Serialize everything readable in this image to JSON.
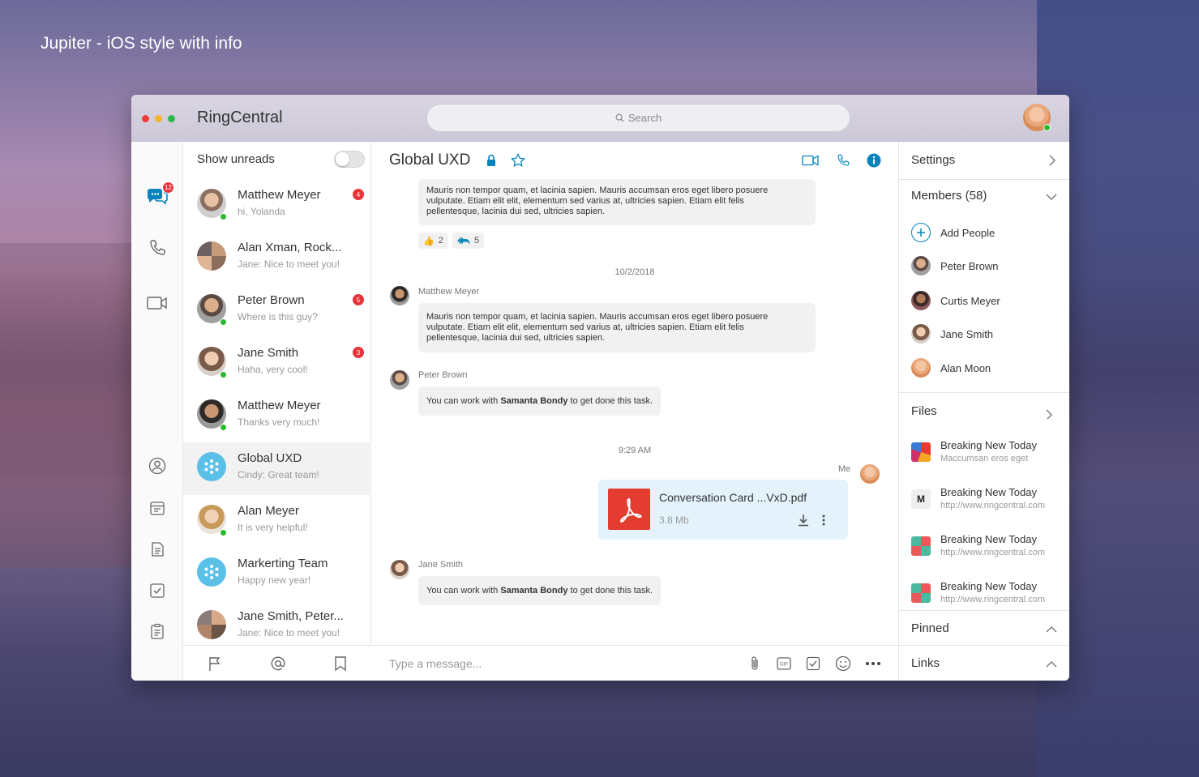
{
  "caption": "Jupiter - iOS style with info",
  "app": {
    "title": "RingCentral",
    "search_placeholder": "Search",
    "rail_badge": "12"
  },
  "convlist": {
    "show_unreads": "Show unreads",
    "items": [
      {
        "name": "Matthew Meyer",
        "preview": "hi, Yolanda",
        "badge": "4"
      },
      {
        "name": "Alan Xman, Rock...",
        "preview": "Jane: Nice to meet you!",
        "badge": ""
      },
      {
        "name": "Peter Brown",
        "preview": "Where is this guy?",
        "badge": "5"
      },
      {
        "name": "Jane Smith",
        "preview": "Haha, very cool!",
        "badge": "3"
      },
      {
        "name": "Matthew Meyer",
        "preview": "Thanks very much!",
        "badge": ""
      },
      {
        "name": "Global UXD",
        "preview": "Cindy: Great team!",
        "badge": ""
      },
      {
        "name": "Alan Meyer",
        "preview": "It is very helpful!",
        "badge": ""
      },
      {
        "name": "Markerting Team",
        "preview": "Happy new year!",
        "badge": ""
      },
      {
        "name": "Jane Smith, Peter...",
        "preview": "Jane: Nice to meet you!",
        "badge": ""
      }
    ]
  },
  "chat": {
    "title": "Global UXD",
    "lorem": "Mauris non tempor quam, et lacinia sapien. Mauris accumsan eros eget libero posuere vulputate. Etiam elit elit, elementum sed varius at, ultricies sapien.",
    "lorem_l1": "Mauris non tempor quam, et lacinia sapien. Mauris accumsan eros eget libero posuere",
    "lorem_l2": "vulputate. Etiam elit elit, elementum sed varius at, lacinia dui sed, ultricies sapien.",
    "lorem_l2a": "vulputate. Etiam elit elit, elementum sed varius at, ultricies sapien. Etiam elit felis",
    "lorem_l3": "pellentesque, lacinia dui sed, ultricies sapien.",
    "reaction_thumbs": "2",
    "reaction_reply": "5",
    "date1": "10/2/2018",
    "sender_matthew": "Matthew Meyer",
    "sender_peter": "Peter Brown",
    "task_prefix": "You can work with ",
    "task_name": "Samanta Bondy",
    "task_suffix": " to get done this task.",
    "time1": "9:29 AM",
    "me_label": "Me",
    "file_name": "Conversation Card ...VxD.pdf",
    "file_size": "3.8 Mb",
    "sender_jane": "Jane Smith",
    "composer_placeholder": "Type a message..."
  },
  "rpanel": {
    "settings": "Settings",
    "members_title": "Members (58)",
    "add_people": "Add People",
    "members": [
      "Peter Brown",
      "Curtis Meyer",
      "Jane Smith",
      "Alan Moon"
    ],
    "files_title": "Files",
    "files": [
      {
        "name": "Breaking New Today",
        "sub": "Maccumsan eros eget"
      },
      {
        "name": "Breaking New Today",
        "sub": "http://www.ringcentral.com"
      },
      {
        "name": "Breaking New Today",
        "sub": "http://www.ringcentral.com"
      },
      {
        "name": "Breaking New Today",
        "sub": "http://www.ringcentral.com"
      }
    ],
    "pinned": "Pinned",
    "links": "Links"
  },
  "colors": {
    "accent": "#0684bd",
    "badge": "#e8333a",
    "online": "#2eb82e",
    "pdf": "#e43c30"
  }
}
